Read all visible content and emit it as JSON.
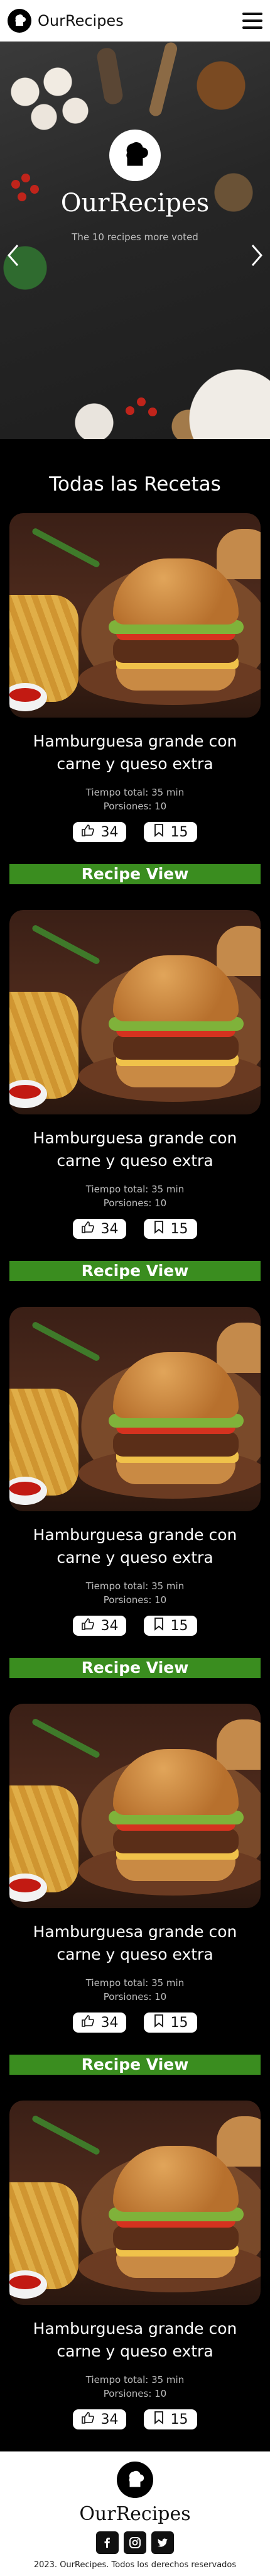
{
  "header": {
    "brand": "OurRecipes",
    "menu_icon": "hamburger-menu-icon",
    "logo_icon": "chef-hat-icon"
  },
  "hero": {
    "title": "OurRecipes",
    "subtitle": "The 10 recipes more voted",
    "logo_icon": "chef-hat-icon"
  },
  "section": {
    "title": "Todas las Recetas"
  },
  "recipes": [
    {
      "title": "Hamburguesa grande con carne y queso extra",
      "time": "Tiempo total: 35 min",
      "portions": "Porsiones: 10",
      "likes": "34",
      "saves": "15",
      "button": "Recipe View"
    },
    {
      "title": "Hamburguesa grande con carne y queso extra",
      "time": "Tiempo total: 35 min",
      "portions": "Porsiones: 10",
      "likes": "34",
      "saves": "15",
      "button": "Recipe View"
    },
    {
      "title": "Hamburguesa grande con carne y queso extra",
      "time": "Tiempo total: 35 min",
      "portions": "Porsiones: 10",
      "likes": "34",
      "saves": "15",
      "button": "Recipe View"
    },
    {
      "title": "Hamburguesa grande con carne y queso extra",
      "time": "Tiempo total: 35 min",
      "portions": "Porsiones: 10",
      "likes": "34",
      "saves": "15",
      "button": "Recipe View"
    },
    {
      "title": "Hamburguesa grande con carne y queso extra",
      "time": "Tiempo total: 35 min",
      "portions": "Porsiones: 10",
      "likes": "34",
      "saves": "15"
    }
  ],
  "footer": {
    "brand": "OurRecipes",
    "copyright": "2023. OurRecipes. Todos los derechos reservados",
    "social": [
      "facebook-icon",
      "instagram-icon",
      "twitter-icon"
    ]
  },
  "colors": {
    "accent": "#3a8d1f",
    "background": "#000000"
  }
}
